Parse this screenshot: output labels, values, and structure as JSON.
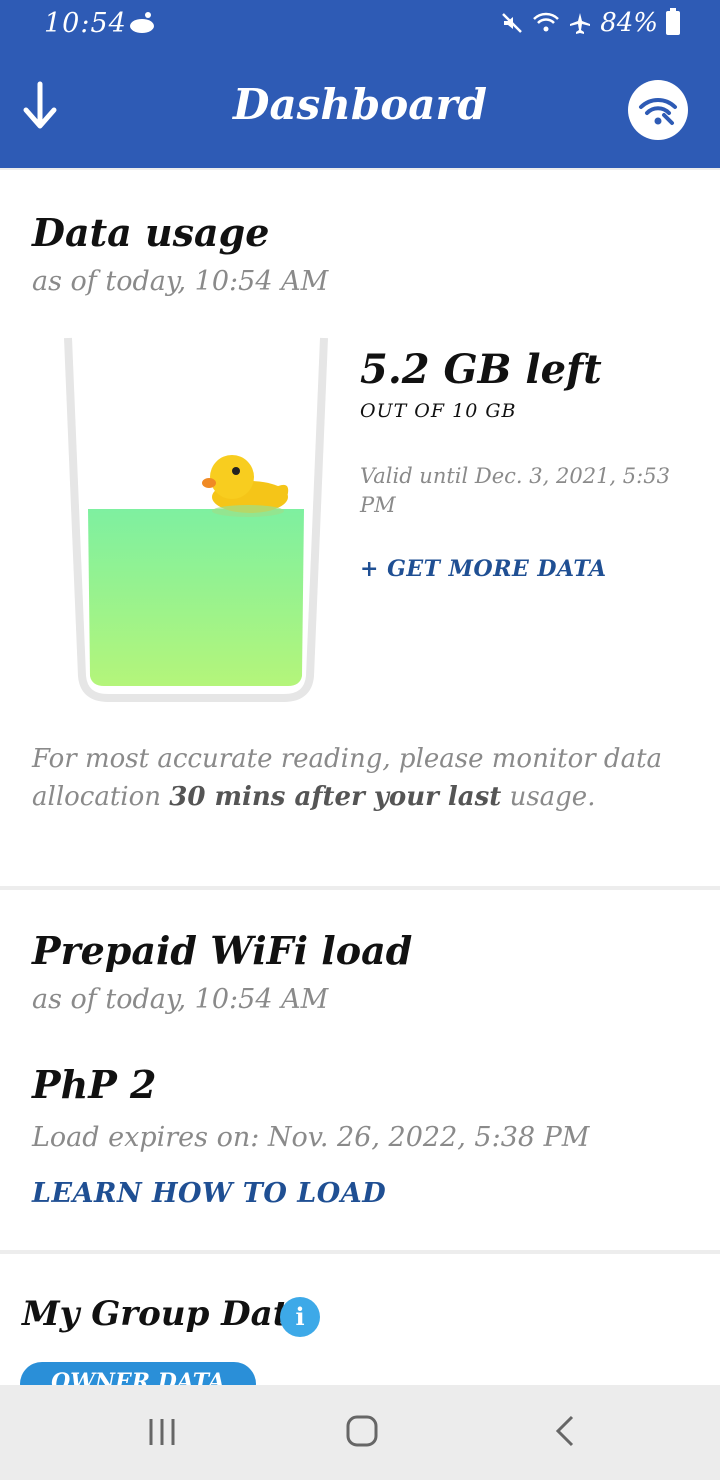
{
  "status_bar": {
    "time": "10:54",
    "battery": "84%"
  },
  "header": {
    "title": "Dashboard"
  },
  "data_usage": {
    "title": "Data usage",
    "as_of": "as of today, 10:54 AM",
    "left_value": "5.2 GB left",
    "out_of": "OUT OF 10 GB",
    "valid_until": "Valid until Dec. 3, 2021, 5:53 PM",
    "get_more": "+ GET MORE DATA",
    "note_start": "For most accurate reading, please monitor data allocation ",
    "note_bold": "30 mins after your last",
    "note_end": " usage.",
    "fill_fraction": 0.52
  },
  "prepaid": {
    "title": "Prepaid WiFi load",
    "as_of": "as of today, 10:54 AM",
    "amount": "PhP 2",
    "expires": "Load expires on: Nov. 26, 2022, 5:38 PM",
    "learn": "LEARN HOW TO LOAD"
  },
  "group": {
    "title": "My Group Data",
    "info": "i",
    "owner_tab": "OWNER DATA"
  },
  "colors": {
    "header_bg": "#2e5bb5",
    "link": "#1f4f93",
    "info": "#3da9e8",
    "fill_top": "#7ef0a0",
    "fill_bottom": "#b4f57a"
  },
  "icons": {
    "back": "arrow-down-icon",
    "wifi": "wifi-icon",
    "mascot": "duck-icon"
  }
}
